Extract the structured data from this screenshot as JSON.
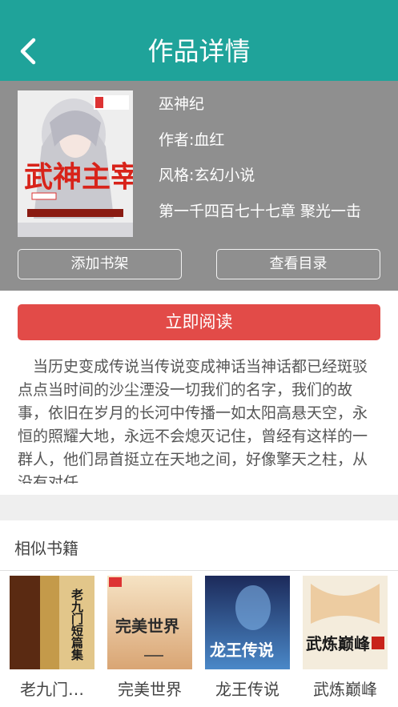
{
  "header": {
    "title": "作品详情",
    "back_icon": "chevron-left-icon"
  },
  "book": {
    "title": "巫神纪",
    "author": "作者:血红",
    "genre": "风格:玄幻小说",
    "latest_chapter": "第一千四百七十七章 聚光一击",
    "cover_art_text": "武神主宰"
  },
  "actions": {
    "add_shelf": "添加书架",
    "view_catalog": "查看目录",
    "read_now": "立即阅读"
  },
  "synopsis": "当历史变成传说当传说变成神话当神话都已经斑驳点点当时间的沙尘湮没一切我们的名字，我们的故事，依旧在岁月的长河中传播一如太阳高悬天空，永恒的照耀大地，永远不会熄灭记住，曾经有这样的一群人，他们昂首挺立在天地之间，好像擎天之柱，从没有对任…",
  "similar": {
    "title": "相似书籍",
    "books": [
      {
        "title": "老九门…",
        "cover_text": "老九门短篇集",
        "cover_color": "#b58a3a"
      },
      {
        "title": "完美世界",
        "cover_text": "完美世界",
        "cover_color": "#e8c9a0"
      },
      {
        "title": "龙王传说",
        "cover_text": "龙王传说",
        "cover_color": "#2a3f7a"
      },
      {
        "title": "武炼巅峰",
        "cover_text": "武炼巅峰",
        "cover_color": "#f3ead8"
      }
    ]
  },
  "colors": {
    "header": "#1fa39a",
    "info_bg": "#8f8f8f",
    "read_button": "#e24b48"
  }
}
